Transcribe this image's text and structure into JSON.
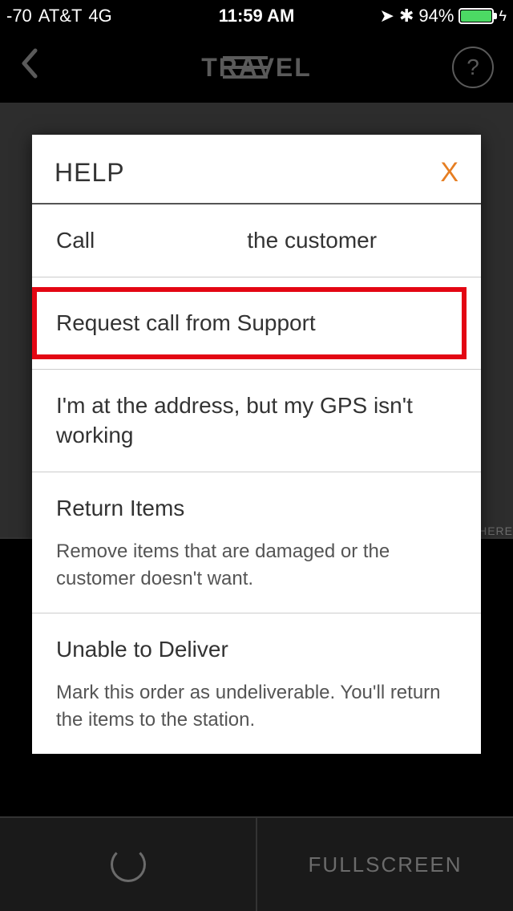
{
  "status": {
    "signal": "-70",
    "carrier": "AT&T",
    "network": "4G",
    "time": "11:59 AM",
    "battery_pct": "94%"
  },
  "header": {
    "title": "TRAVEL",
    "help_label": "?"
  },
  "background": {
    "here_text": "HERE",
    "fullscreen": "FULLSCREEN"
  },
  "modal": {
    "title": "HELP",
    "close": "X",
    "options": {
      "call": {
        "prefix": "Call",
        "suffix": "the customer"
      },
      "request": "Request call from Support",
      "gps": "I'm at the address, but my GPS isn't working",
      "return_title": "Return Items",
      "return_sub": "Remove items that are damaged or the customer doesn't want.",
      "undeliver_title": "Unable to Deliver",
      "undeliver_sub": "Mark this order as undeliverable. You'll return the items to the station."
    }
  }
}
